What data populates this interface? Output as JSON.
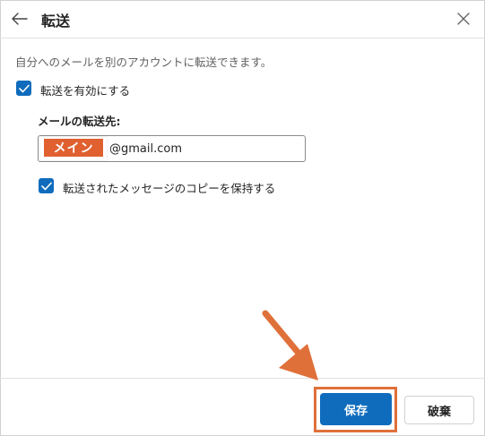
{
  "header": {
    "title": "転送",
    "back_icon": "arrow-left-icon",
    "close_icon": "close-icon"
  },
  "description": "自分へのメールを別のアカウントに転送できます。",
  "enable_forwarding": {
    "label": "転送を有効にする",
    "checked": true
  },
  "forward_to": {
    "label": "メールの転送先:",
    "value_domain": "@gmail.com",
    "redaction_label": "メイン"
  },
  "keep_copy": {
    "label": "転送されたメッセージのコピーを保持する",
    "checked": true
  },
  "footer": {
    "save_label": "保存",
    "discard_label": "破棄"
  },
  "colors": {
    "accent": "#0f6cbd",
    "annotation": "#e0703a"
  }
}
